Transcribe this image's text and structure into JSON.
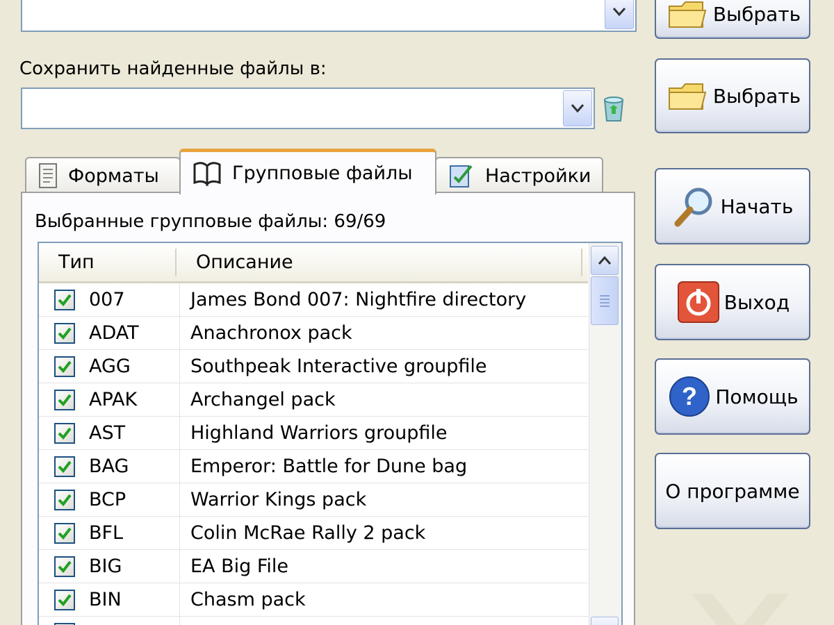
{
  "top_combo": {
    "value": ""
  },
  "save_section": {
    "label": "Сохранить найденные файлы в:",
    "path_value": ""
  },
  "buttons": {
    "select_top": "Выбрать",
    "select_save": "Выбрать",
    "start": "Начать",
    "exit": "Выход",
    "help": "Помощь",
    "about": "О программе"
  },
  "tabs": [
    {
      "label": "Форматы",
      "icon": "document-icon"
    },
    {
      "label": "Групповые файлы",
      "icon": "book-icon"
    },
    {
      "label": "Настройки",
      "icon": "settings-icon"
    }
  ],
  "active_tab": "Групповые файлы",
  "group_panel": {
    "selected_label": "Выбранные групповые файлы: 69/69",
    "columns": {
      "type": "Тип",
      "description": "Описание"
    },
    "rows": [
      {
        "type": "007",
        "description": "James Bond 007: Nightfire directory",
        "checked": true
      },
      {
        "type": "ADAT",
        "description": "Anachronox pack",
        "checked": true
      },
      {
        "type": "AGG",
        "description": "Southpeak Interactive groupfile",
        "checked": true
      },
      {
        "type": "APAK",
        "description": "Archangel pack",
        "checked": true
      },
      {
        "type": "AST",
        "description": "Highland Warriors groupfile",
        "checked": true
      },
      {
        "type": "BAG",
        "description": "Emperor: Battle for Dune bag",
        "checked": true
      },
      {
        "type": "BCP",
        "description": "Warrior Kings pack",
        "checked": true
      },
      {
        "type": "BFL",
        "description": "Colin McRae Rally 2 pack",
        "checked": true
      },
      {
        "type": "BIG",
        "description": "EA Big File",
        "checked": true
      },
      {
        "type": "BIN",
        "description": "Chasm pack",
        "checked": true
      },
      {
        "type": "",
        "description": "",
        "checked": true
      }
    ]
  },
  "colors": {
    "window_bg": "#ece9d8",
    "active_tab_accent": "#e8a33d",
    "check_green": "#21a121",
    "field_border": "#7f9db9"
  }
}
